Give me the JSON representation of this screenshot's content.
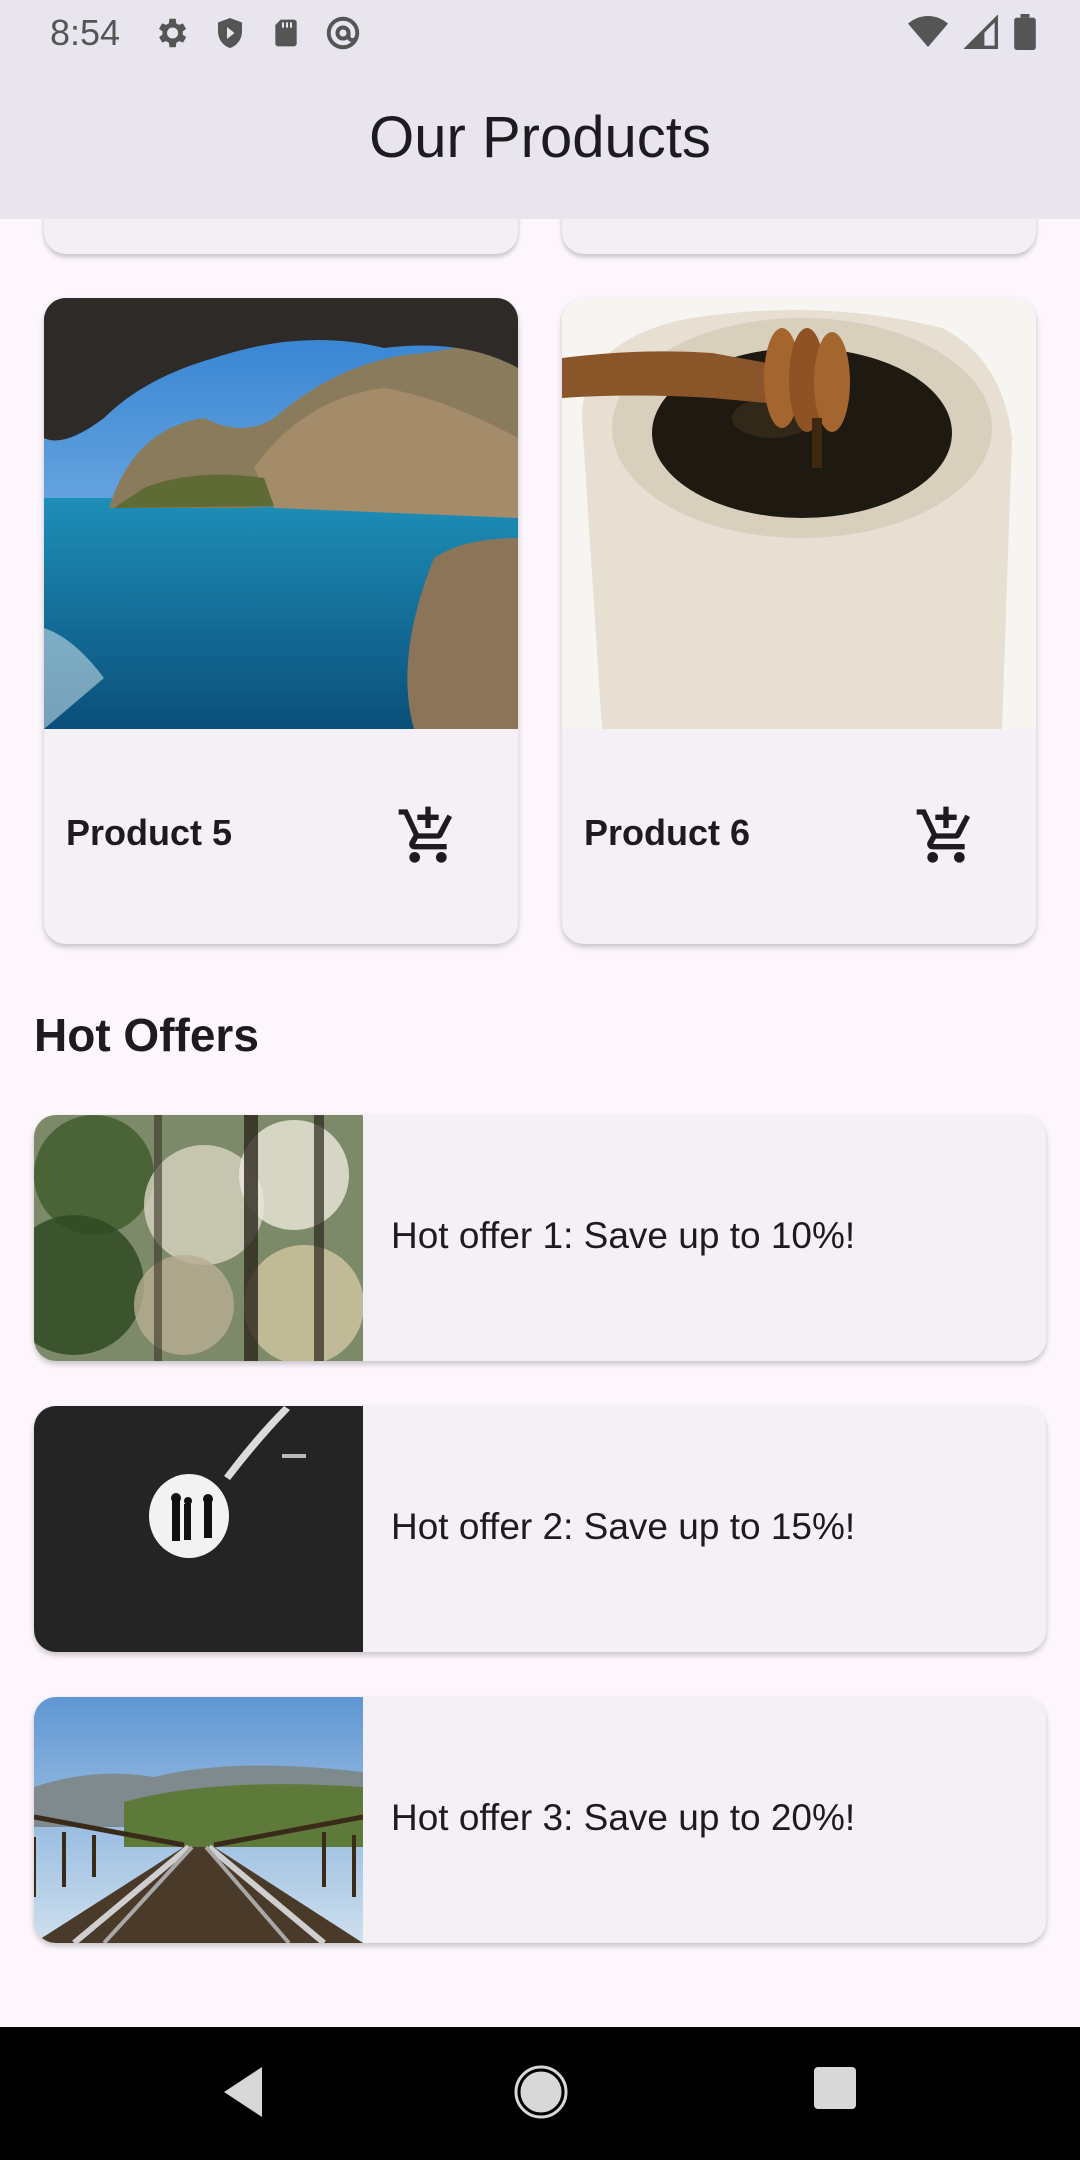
{
  "status_bar": {
    "time": "8:54",
    "left_icons": [
      "settings-icon",
      "shield-icon",
      "sd-card-icon",
      "at-sign-icon"
    ],
    "right_icons": [
      "wifi-icon",
      "cell-signal-icon",
      "battery-icon"
    ]
  },
  "app_bar": {
    "title": "Our Products"
  },
  "products": [
    {
      "name": "Product 5",
      "image": "sea-cave-coast-photo",
      "action_icon": "add-shopping-cart-icon"
    },
    {
      "name": "Product 6",
      "image": "honey-jar-dipper-photo",
      "action_icon": "add-shopping-cart-icon"
    }
  ],
  "hot_offers": {
    "title": "Hot Offers",
    "items": [
      {
        "text": "Hot offer 1: Save up to 10%!",
        "image": "forest-bokeh-photo"
      },
      {
        "text": "Hot offer 2: Save up to 15%!",
        "image": "dark-tunnel-silhouettes-photo"
      },
      {
        "text": "Hot offer 3: Save up to 20%!",
        "image": "railway-bridge-tracks-photo"
      }
    ]
  },
  "nav_bar": {
    "buttons": [
      "back-icon",
      "home-icon",
      "recents-icon"
    ]
  },
  "colors": {
    "background": "#fdf7fd",
    "app_bar": "#e9e5ef",
    "card": "#f5f0f6",
    "text": "#1d1b20"
  }
}
